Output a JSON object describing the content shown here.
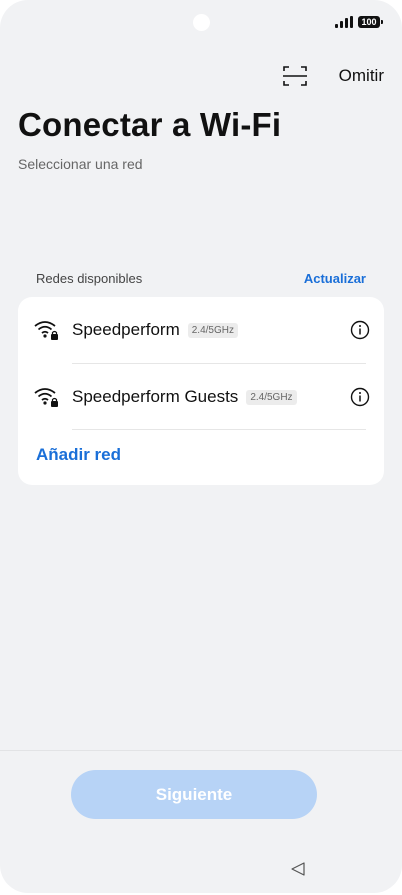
{
  "status": {
    "battery": "100"
  },
  "topbar": {
    "skip_label": "Omitir"
  },
  "header": {
    "title": "Conectar a Wi-Fi",
    "subtitle": "Seleccionar una red"
  },
  "networks_section": {
    "label": "Redes disponibles",
    "refresh_label": "Actualizar",
    "items": [
      {
        "name": "Speedperform",
        "band": "2.4/5GHz",
        "secured": true
      },
      {
        "name": "Speedperform Guests",
        "band": "2.4/5GHz",
        "secured": true
      }
    ],
    "add_label": "Añadir red"
  },
  "footer": {
    "next_label": "Siguiente"
  },
  "colors": {
    "accent": "#1a6fd8",
    "button_disabled": "#b7d3f6",
    "background": "#f1f2f4"
  },
  "icons": [
    "signal-icon",
    "battery-icon",
    "scan-icon",
    "wifi-lock-icon",
    "info-icon",
    "back-triangle-icon"
  ]
}
